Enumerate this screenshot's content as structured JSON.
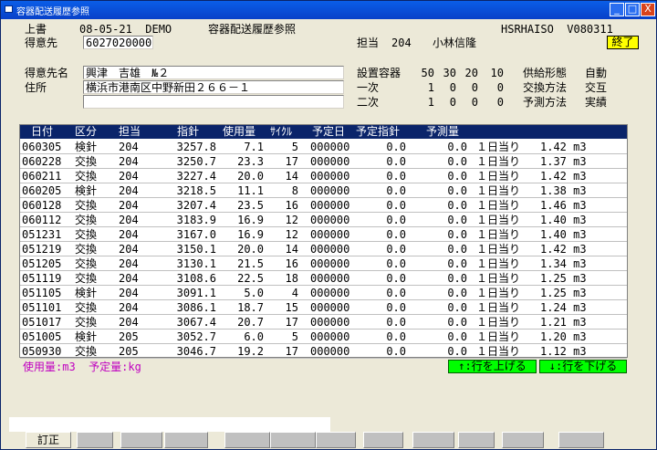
{
  "window": {
    "title": "容器配送履歴参照",
    "minimize_label": "_",
    "maximize_label": "□",
    "close_label": "X"
  },
  "header": {
    "mode": "上書",
    "date_user": "08-05-21  DEMO",
    "screen_title": "容器配送履歴参照",
    "program_id": "HSRHAISO  V080311",
    "end_button": "終了",
    "customer_code_label": "得意先",
    "customer_code": "6027020000",
    "staff_label": "担当",
    "staff_code": "204",
    "staff_name": "小林信隆"
  },
  "customer": {
    "name_label": "得意先名",
    "name": "興津　吉雄　№２",
    "address_label": "住所",
    "address1": "横浜市港南区中野新田２６６－１",
    "address2": ""
  },
  "containers": {
    "label": "設置容器",
    "sizes": [
      "50",
      "30",
      "20",
      "10"
    ],
    "primary_label": "一次",
    "primary": [
      "1",
      "0",
      "0",
      "0"
    ],
    "secondary_label": "二次",
    "secondary": [
      "1",
      "0",
      "0",
      "0"
    ]
  },
  "supply": {
    "type_label": "供給形態",
    "type_value": "自動",
    "exchange_label": "交換方法",
    "exchange_value": "交互",
    "forecast_label": "予測方法",
    "forecast_value": "実績"
  },
  "table": {
    "columns": [
      "日付",
      "区分",
      "担当",
      "指針",
      "使用量",
      "ｻｲｸﾙ",
      "予定日",
      "予定指針",
      "予測量"
    ],
    "rows": [
      [
        "060305",
        "検針",
        "204",
        "3257.8",
        "7.1",
        "5",
        "000000",
        "0.0",
        "0.0",
        "１日当り",
        "1.42 m3"
      ],
      [
        "060228",
        "交換",
        "204",
        "3250.7",
        "23.3",
        "17",
        "000000",
        "0.0",
        "0.0",
        "１日当り",
        "1.37 m3"
      ],
      [
        "060211",
        "交換",
        "204",
        "3227.4",
        "20.0",
        "14",
        "000000",
        "0.0",
        "0.0",
        "１日当り",
        "1.42 m3"
      ],
      [
        "060205",
        "検針",
        "204",
        "3218.5",
        "11.1",
        "8",
        "000000",
        "0.0",
        "0.0",
        "１日当り",
        "1.38 m3"
      ],
      [
        "060128",
        "交換",
        "204",
        "3207.4",
        "23.5",
        "16",
        "000000",
        "0.0",
        "0.0",
        "１日当り",
        "1.46 m3"
      ],
      [
        "060112",
        "交換",
        "204",
        "3183.9",
        "16.9",
        "12",
        "000000",
        "0.0",
        "0.0",
        "１日当り",
        "1.40 m3"
      ],
      [
        "051231",
        "交換",
        "204",
        "3167.0",
        "16.9",
        "12",
        "000000",
        "0.0",
        "0.0",
        "１日当り",
        "1.40 m3"
      ],
      [
        "051219",
        "交換",
        "204",
        "3150.1",
        "20.0",
        "14",
        "000000",
        "0.0",
        "0.0",
        "１日当り",
        "1.42 m3"
      ],
      [
        "051205",
        "交換",
        "204",
        "3130.1",
        "21.5",
        "16",
        "000000",
        "0.0",
        "0.0",
        "１日当り",
        "1.34 m3"
      ],
      [
        "051119",
        "交換",
        "204",
        "3108.6",
        "22.5",
        "18",
        "000000",
        "0.0",
        "0.0",
        "１日当り",
        "1.25 m3"
      ],
      [
        "051105",
        "検針",
        "204",
        "3091.1",
        "5.0",
        "4",
        "000000",
        "0.0",
        "0.0",
        "１日当り",
        "1.25 m3"
      ],
      [
        "051101",
        "交換",
        "204",
        "3086.1",
        "18.7",
        "15",
        "000000",
        "0.0",
        "0.0",
        "１日当り",
        "1.24 m3"
      ],
      [
        "051017",
        "交換",
        "204",
        "3067.4",
        "20.7",
        "17",
        "000000",
        "0.0",
        "0.0",
        "１日当り",
        "1.21 m3"
      ],
      [
        "051005",
        "検針",
        "205",
        "3052.7",
        "6.0",
        "5",
        "000000",
        "0.0",
        "0.0",
        "１日当り",
        "1.20 m3"
      ],
      [
        "050930",
        "交換",
        "205",
        "3046.7",
        "19.2",
        "17",
        "000000",
        "0.0",
        "0.0",
        "１日当り",
        "1.12 m3"
      ]
    ]
  },
  "footer": {
    "units_note": "使用量:m3  予定量:kg",
    "row_up_button": "↑:行を上げる",
    "row_down_button": "↓:行を下げる",
    "function_keys": [
      "訂正",
      "",
      "",
      "",
      "",
      "",
      "",
      "",
      "",
      "",
      "",
      ""
    ]
  }
}
